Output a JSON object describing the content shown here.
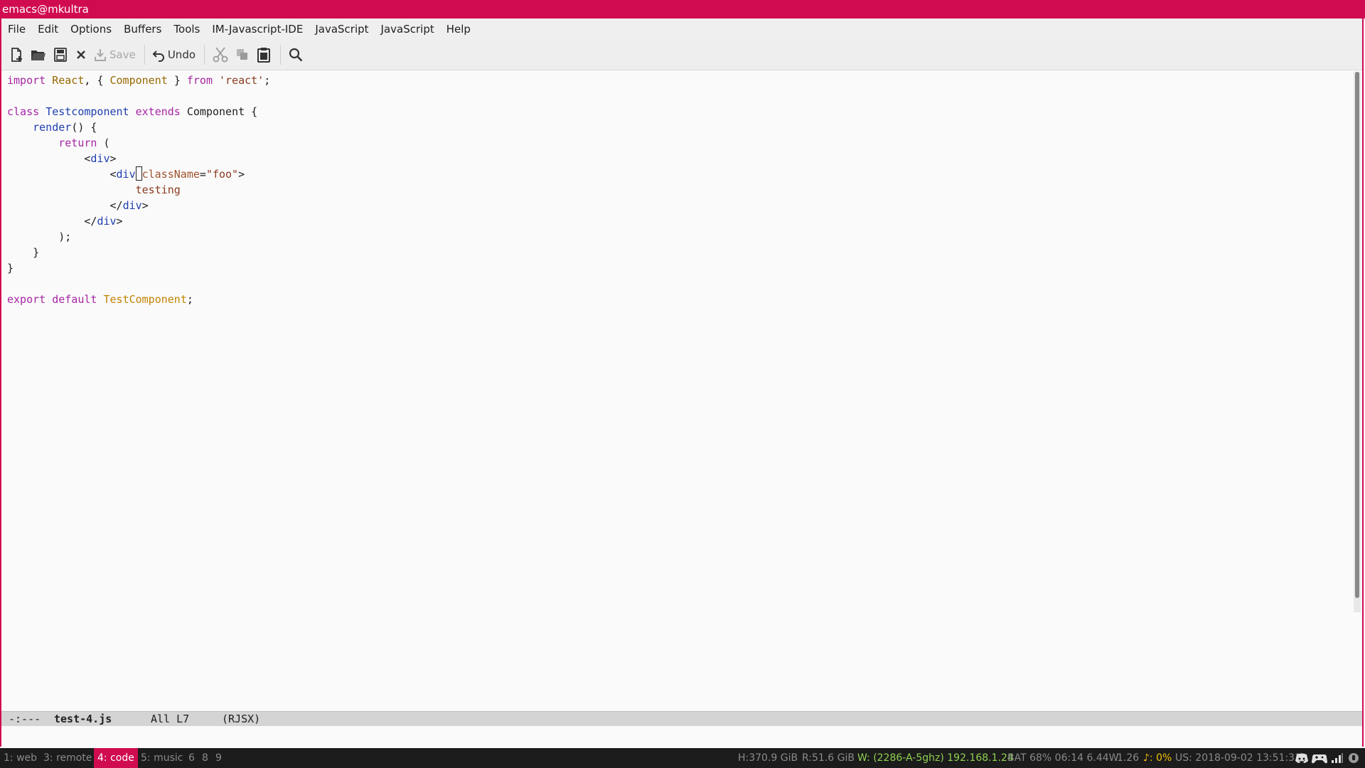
{
  "window": {
    "title": "emacs@mkultra"
  },
  "menu": [
    "File",
    "Edit",
    "Options",
    "Buffers",
    "Tools",
    "IM-Javascript-IDE",
    "JavaScript",
    "JavaScript",
    "Help"
  ],
  "toolbar": {
    "save_label": "Save",
    "undo_label": "Undo"
  },
  "editor": {
    "import_kw": "import",
    "react": "React",
    "brace_open": "{",
    "component": "Component",
    "brace_close": "}",
    "from_kw": "from",
    "react_str": "'react'",
    "class_kw": "class",
    "class_name": "Testcomponent",
    "extends_kw": "extends",
    "base_class": "Component",
    "render_fn": "render",
    "return_kw": "return",
    "div_tag": "div",
    "class_attr": "className",
    "class_value": "\"foo\"",
    "text_content": "testing",
    "export_kw": "export",
    "default_kw": "default",
    "export_name": "TestComponent"
  },
  "modeline": {
    "status": "-:---",
    "filename": "test-4.js",
    "position": "All L7",
    "mode": "(RJSX)"
  },
  "statusbar": {
    "workspaces": [
      {
        "label": "1: web",
        "active": false
      },
      {
        "label": "3: remote",
        "active": false
      },
      {
        "label": "4: code",
        "active": true
      },
      {
        "label": "5: music",
        "active": false
      },
      {
        "label": "6",
        "active": false
      },
      {
        "label": "8",
        "active": false
      },
      {
        "label": "9",
        "active": false
      }
    ],
    "disk_home": "H:370.9 GiB",
    "disk_root": "R:51.6 GiB",
    "wifi": "W: (2286-A-5ghz) 192.168.1.24",
    "battery": "BAT 68% 06:14 6.44W",
    "load": "1.26",
    "volume": "♪: 0%",
    "datetime": "US: 2018-09-02 13:51:31"
  },
  "colors": {
    "accent": "#d10b50",
    "bar_bg": "#1c1c1c",
    "green": "#8fd14f",
    "yellow": "#f2c200"
  },
  "icons": [
    "new-file-icon",
    "open-folder-icon",
    "save-disk-icon",
    "close-icon",
    "save-icon",
    "undo-icon",
    "cut-icon",
    "copy-icon",
    "paste-icon",
    "search-icon",
    "discord-icon",
    "gamepad-icon",
    "signal-icon",
    "shield-icon"
  ]
}
